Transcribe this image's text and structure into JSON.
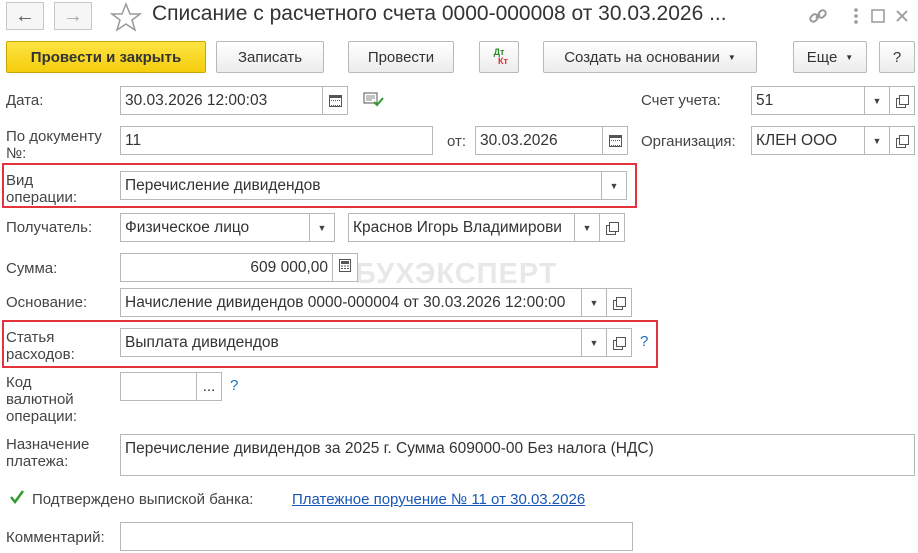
{
  "title": "Списание с расчетного счета 0000-000008 от 30.03.2026 ...",
  "nav": {
    "back_glyph": "←",
    "forward_glyph": "→"
  },
  "title_icons": [
    "star-icon",
    "link-icon",
    "more-vertical-icon",
    "maximize-icon",
    "close-icon"
  ],
  "toolbar": {
    "post_close": "Провести и закрыть",
    "save": "Записать",
    "post": "Провести",
    "dtkt_dt": "Дт",
    "dtkt_kt": "Кт",
    "create_based": "Создать на основании",
    "more": "Еще",
    "help": "?"
  },
  "form": {
    "date": {
      "label": "Дата:",
      "value": "30.03.2026 12:00:03"
    },
    "account": {
      "label": "Счет учета:",
      "value": "51"
    },
    "doc_number": {
      "label": "По документу №:",
      "label_line1": "По документу",
      "label_line2": "№:",
      "value": "11",
      "from_label": "от:",
      "from_value": "30.03.2026"
    },
    "organization": {
      "label": "Организация:",
      "value": "КЛЕН ООО"
    },
    "operation_type": {
      "label_line1": "Вид",
      "label_line2": "операции:",
      "value": "Перечисление дивидендов"
    },
    "recipient": {
      "label": "Получатель:",
      "type_value": "Физическое лицо",
      "person_value": "Краснов Игорь Владимирови"
    },
    "amount": {
      "label": "Сумма:",
      "value": "609 000,00"
    },
    "basis": {
      "label": "Основание:",
      "value": "Начисление дивидендов 0000-000004 от 30.03.2026 12:00:00"
    },
    "expense_item": {
      "label_line1": "Статья",
      "label_line2": "расходов:",
      "value": "Выплата дивидендов",
      "help": "?"
    },
    "currency_code": {
      "label_line1": "Код",
      "label_line2": "валютной",
      "label_line3": "операции:",
      "value": "",
      "select_glyph": "...",
      "help": "?"
    },
    "purpose": {
      "label_line1": "Назначение",
      "label_line2": "платежа:",
      "value": "Перечисление дивидендов за 2025 г. Сумма 609000-00 Без налога (НДС)"
    },
    "confirmed": {
      "label": "Подтверждено выпиской банка:",
      "checked": true,
      "link": "Платежное поручение № 11 от 30.03.2026"
    },
    "comment": {
      "label": "Комментарий:",
      "value": ""
    }
  },
  "watermark": "БУХЭКСПЕРТ",
  "colors": {
    "primary_button": "#f4cd0d",
    "highlight_border": "#e2343a",
    "link": "#1a57b5"
  }
}
